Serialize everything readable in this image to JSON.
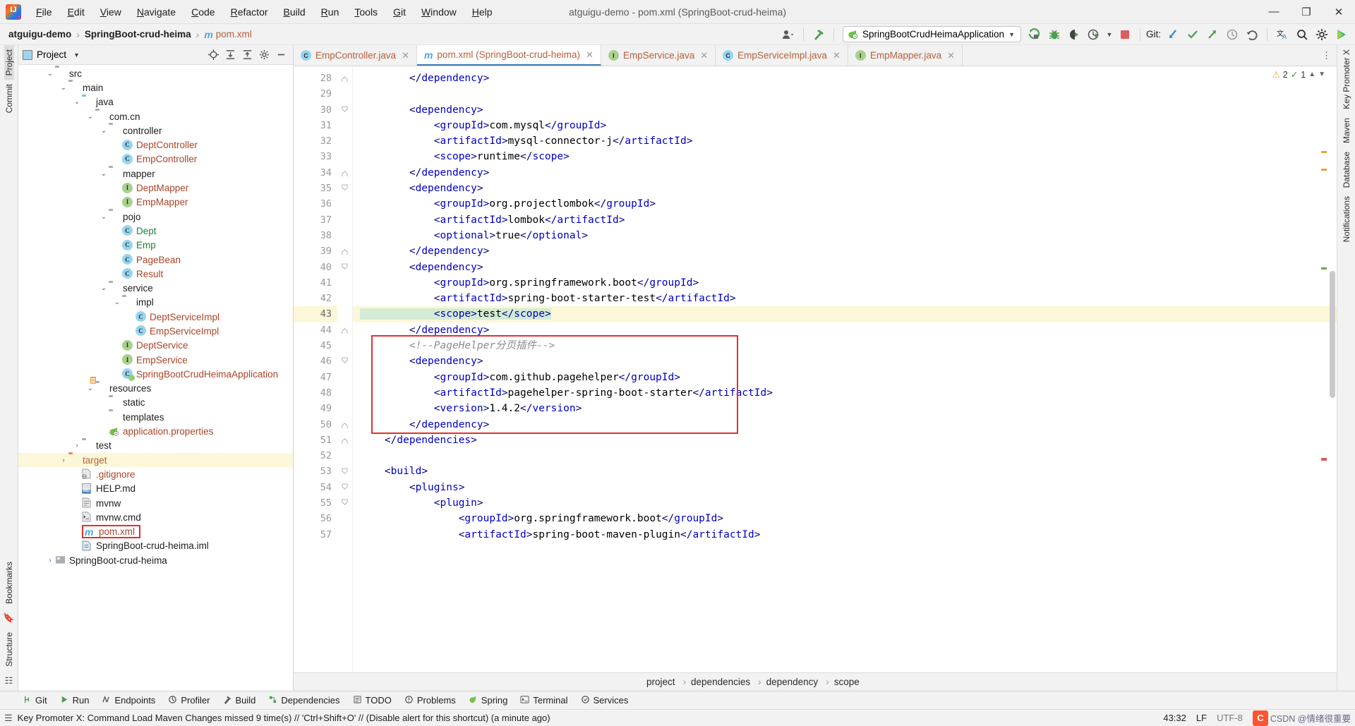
{
  "window": {
    "title": "atguigu-demo - pom.xml (SpringBoot-crud-heima)",
    "minimize": "—",
    "maximize": "❐",
    "close": "✕"
  },
  "menubar": {
    "items": [
      "File",
      "Edit",
      "View",
      "Navigate",
      "Code",
      "Refactor",
      "Build",
      "Run",
      "Tools",
      "Git",
      "Window",
      "Help"
    ]
  },
  "breadcrumb": {
    "project": "atguigu-demo",
    "module": "SpringBoot-crud-heima",
    "file": "pom.xml"
  },
  "toolbar": {
    "run_config": "SpringBootCrudHeimaApplication",
    "git_label": "Git:",
    "icons": [
      "user-dropdown-icon",
      "build-hammer-icon",
      "run-icon",
      "debug-icon",
      "run-coverage-icon",
      "profiler-icon",
      "stop-icon",
      "git-update-icon",
      "git-commit-icon",
      "git-push-icon",
      "git-history-icon",
      "git-rollback-icon",
      "translate-icon",
      "search-icon",
      "settings-icon",
      "ai-assistant-icon"
    ]
  },
  "project_panel": {
    "title": "Project",
    "actions": [
      "locate-icon",
      "expand-all-icon",
      "collapse-all-icon",
      "settings-icon",
      "hide-icon"
    ],
    "tree": [
      {
        "label": "src",
        "indent": 2,
        "arrow": "⌄",
        "kind": "folder",
        "color": "n-dark"
      },
      {
        "label": "main",
        "indent": 3,
        "arrow": "⌄",
        "kind": "folder",
        "color": "n-dark"
      },
      {
        "label": "java",
        "indent": 4,
        "arrow": "⌄",
        "kind": "folder-blue",
        "color": "n-dark"
      },
      {
        "label": "com.cn",
        "indent": 5,
        "arrow": "⌄",
        "kind": "folder-pkg",
        "color": "n-dark"
      },
      {
        "label": "controller",
        "indent": 6,
        "arrow": "⌄",
        "kind": "folder-pkg",
        "color": "n-dark"
      },
      {
        "label": "DeptController",
        "indent": 7,
        "arrow": "",
        "kind": "class",
        "color": "n-red"
      },
      {
        "label": "EmpController",
        "indent": 7,
        "arrow": "",
        "kind": "class",
        "color": "n-red"
      },
      {
        "label": "mapper",
        "indent": 6,
        "arrow": "⌄",
        "kind": "folder-pkg",
        "color": "n-dark"
      },
      {
        "label": "DeptMapper",
        "indent": 7,
        "arrow": "",
        "kind": "interface",
        "color": "n-red"
      },
      {
        "label": "EmpMapper",
        "indent": 7,
        "arrow": "",
        "kind": "interface",
        "color": "n-red"
      },
      {
        "label": "pojo",
        "indent": 6,
        "arrow": "⌄",
        "kind": "folder-pkg",
        "color": "n-dark"
      },
      {
        "label": "Dept",
        "indent": 7,
        "arrow": "",
        "kind": "class",
        "color": "n-green"
      },
      {
        "label": "Emp",
        "indent": 7,
        "arrow": "",
        "kind": "class",
        "color": "n-green"
      },
      {
        "label": "PageBean",
        "indent": 7,
        "arrow": "",
        "kind": "class",
        "color": "n-red"
      },
      {
        "label": "Result",
        "indent": 7,
        "arrow": "",
        "kind": "class",
        "color": "n-red"
      },
      {
        "label": "service",
        "indent": 6,
        "arrow": "⌄",
        "kind": "folder-pkg",
        "color": "n-dark"
      },
      {
        "label": "impl",
        "indent": 7,
        "arrow": "⌄",
        "kind": "folder-pkg",
        "color": "n-dark"
      },
      {
        "label": "DeptServiceImpl",
        "indent": 8,
        "arrow": "",
        "kind": "class",
        "color": "n-red"
      },
      {
        "label": "EmpServiceImpl",
        "indent": 8,
        "arrow": "",
        "kind": "class",
        "color": "n-red"
      },
      {
        "label": "DeptService",
        "indent": 7,
        "arrow": "",
        "kind": "interface",
        "color": "n-red"
      },
      {
        "label": "EmpService",
        "indent": 7,
        "arrow": "",
        "kind": "interface",
        "color": "n-red"
      },
      {
        "label": "SpringBootCrudHeimaApplication",
        "indent": 7,
        "arrow": "",
        "kind": "spring-class",
        "color": "n-red"
      },
      {
        "label": "resources",
        "indent": 5,
        "arrow": "⌄",
        "kind": "folder-res",
        "color": "n-dark"
      },
      {
        "label": "static",
        "indent": 6,
        "arrow": "",
        "kind": "folder",
        "color": "n-dark"
      },
      {
        "label": "templates",
        "indent": 6,
        "arrow": "",
        "kind": "folder",
        "color": "n-dark"
      },
      {
        "label": "application.properties",
        "indent": 6,
        "arrow": "",
        "kind": "spring-leaf",
        "color": "n-red"
      },
      {
        "label": "test",
        "indent": 4,
        "arrow": "›",
        "kind": "folder",
        "color": "n-dark"
      },
      {
        "label": "target",
        "indent": 3,
        "arrow": "›",
        "kind": "folder-orange",
        "color": "n-orange",
        "highlight": true
      },
      {
        "label": ".gitignore",
        "indent": 4,
        "arrow": "",
        "kind": "file-git",
        "color": "n-red"
      },
      {
        "label": "HELP.md",
        "indent": 4,
        "arrow": "",
        "kind": "file-md",
        "color": "n-dark"
      },
      {
        "label": "mvnw",
        "indent": 4,
        "arrow": "",
        "kind": "file-sh",
        "color": "n-dark"
      },
      {
        "label": "mvnw.cmd",
        "indent": 4,
        "arrow": "",
        "kind": "file-cmd",
        "color": "n-dark"
      },
      {
        "label": "pom.xml",
        "indent": 4,
        "arrow": "",
        "kind": "file-maven",
        "color": "n-red",
        "boxed": true
      },
      {
        "label": "SpringBoot-crud-heima.iml",
        "indent": 4,
        "arrow": "",
        "kind": "file-iml",
        "color": "n-dark"
      },
      {
        "label": "SpringBoot-crud-heima",
        "indent": 2,
        "arrow": "›",
        "kind": "module",
        "color": "n-dark"
      }
    ]
  },
  "tabs": [
    {
      "label": "EmpController.java",
      "icon": "class-icon",
      "active": false
    },
    {
      "label": "pom.xml (SpringBoot-crud-heima)",
      "icon": "maven-icon",
      "active": true
    },
    {
      "label": "EmpService.java",
      "icon": "interface-icon",
      "active": false
    },
    {
      "label": "EmpServiceImpl.java",
      "icon": "class-icon",
      "active": false
    },
    {
      "label": "EmpMapper.java",
      "icon": "interface-icon",
      "active": false
    }
  ],
  "inspection": {
    "warnings": "2",
    "weak_warnings": "1"
  },
  "editor": {
    "first_line": 28,
    "current_line": 43,
    "lines": [
      {
        "n": 28,
        "text": "        </dependency>",
        "fold": "end"
      },
      {
        "n": 29,
        "text": ""
      },
      {
        "n": 30,
        "text": "        <dependency>",
        "fold": "start",
        "run": true
      },
      {
        "n": 31,
        "text": "            <groupId>com.mysql</groupId>"
      },
      {
        "n": 32,
        "text": "            <artifactId>mysql-connector-j</artifactId>"
      },
      {
        "n": 33,
        "text": "            <scope>runtime</scope>"
      },
      {
        "n": 34,
        "text": "        </dependency>",
        "fold": "end"
      },
      {
        "n": 35,
        "text": "        <dependency>",
        "fold": "start",
        "run": true
      },
      {
        "n": 36,
        "text": "            <groupId>org.projectlombok</groupId>"
      },
      {
        "n": 37,
        "text": "            <artifactId>lombok</artifactId>"
      },
      {
        "n": 38,
        "text": "            <optional>true</optional>"
      },
      {
        "n": 39,
        "text": "        </dependency>",
        "fold": "end"
      },
      {
        "n": 40,
        "text": "        <dependency>",
        "fold": "start",
        "run": true
      },
      {
        "n": 41,
        "text": "            <groupId>org.springframework.boot</groupId>"
      },
      {
        "n": 42,
        "text": "            <artifactId>spring-boot-starter-test</artifactId>"
      },
      {
        "n": 43,
        "text": "            <scope>test</scope>",
        "bulb": true,
        "highlight_code": true
      },
      {
        "n": 44,
        "text": "        </dependency>",
        "fold": "end"
      },
      {
        "n": 45,
        "text": "        <!--PageHelper分页插件-->",
        "comment": true
      },
      {
        "n": 46,
        "text": "        <dependency>",
        "fold": "start"
      },
      {
        "n": 47,
        "text": "            <groupId>com.github.pagehelper</groupId>"
      },
      {
        "n": 48,
        "text": "            <artifactId>pagehelper-spring-boot-starter</artifactId>"
      },
      {
        "n": 49,
        "text": "            <version>1.4.2</version>"
      },
      {
        "n": 50,
        "text": "        </dependency>",
        "fold": "end"
      },
      {
        "n": 51,
        "text": "    </dependencies>",
        "fold": "end"
      },
      {
        "n": 52,
        "text": ""
      },
      {
        "n": 53,
        "text": "    <build>",
        "fold": "start"
      },
      {
        "n": 54,
        "text": "        <plugins>",
        "fold": "start"
      },
      {
        "n": 55,
        "text": "            <plugin>",
        "fold": "start"
      },
      {
        "n": 56,
        "text": "                <groupId>org.springframework.boot</groupId>"
      },
      {
        "n": 57,
        "text": "                <artifactId>spring-boot-maven-plugin</artifactId>"
      }
    ],
    "crumbs": [
      "project",
      "dependencies",
      "dependency",
      "scope"
    ]
  },
  "left_strip": {
    "items": [
      "Project",
      "Commit"
    ]
  },
  "right_strip": {
    "items": [
      "Key Promoter X",
      "Maven",
      "Database",
      "Notifications"
    ]
  },
  "bottom_strip": {
    "items": [
      "Bookmarks",
      "Structure"
    ]
  },
  "bottom_bar": {
    "items": [
      {
        "label": "Git",
        "icon": "git-branch-icon"
      },
      {
        "label": "Run",
        "icon": "run-icon"
      },
      {
        "label": "Endpoints",
        "icon": "endpoints-icon"
      },
      {
        "label": "Profiler",
        "icon": "profiler-icon"
      },
      {
        "label": "Build",
        "icon": "build-hammer-icon"
      },
      {
        "label": "Dependencies",
        "icon": "dependencies-icon"
      },
      {
        "label": "TODO",
        "icon": "todo-icon"
      },
      {
        "label": "Problems",
        "icon": "problems-icon"
      },
      {
        "label": "Spring",
        "icon": "spring-leaf-icon"
      },
      {
        "label": "Terminal",
        "icon": "terminal-icon"
      },
      {
        "label": "Services",
        "icon": "services-icon"
      }
    ]
  },
  "status_bar": {
    "message": "Key Promoter X: Command Load Maven Changes missed 9 time(s) // 'Ctrl+Shift+O' // (Disable alert for this shortcut) (a minute ago)",
    "caret": "43:32",
    "line_separator": "LF",
    "encoding": "UTF-8",
    "watermark": "CSDN @情绪很重要"
  },
  "colors": {
    "accent_blue": "#3d7ab8",
    "tag_blue": "#0000c0",
    "red_box": "#e03030",
    "highlight_yellow": "#fcf7d8",
    "comment_gray": "#8c8c8c",
    "folder_gray": "#a8b0b5",
    "folder_blue": "#73c3e8",
    "folder_orange": "#f08a5d",
    "class_badge": "#96d5f0",
    "interface_badge": "#a8d18d",
    "csdn_orange": "#fc5531"
  }
}
